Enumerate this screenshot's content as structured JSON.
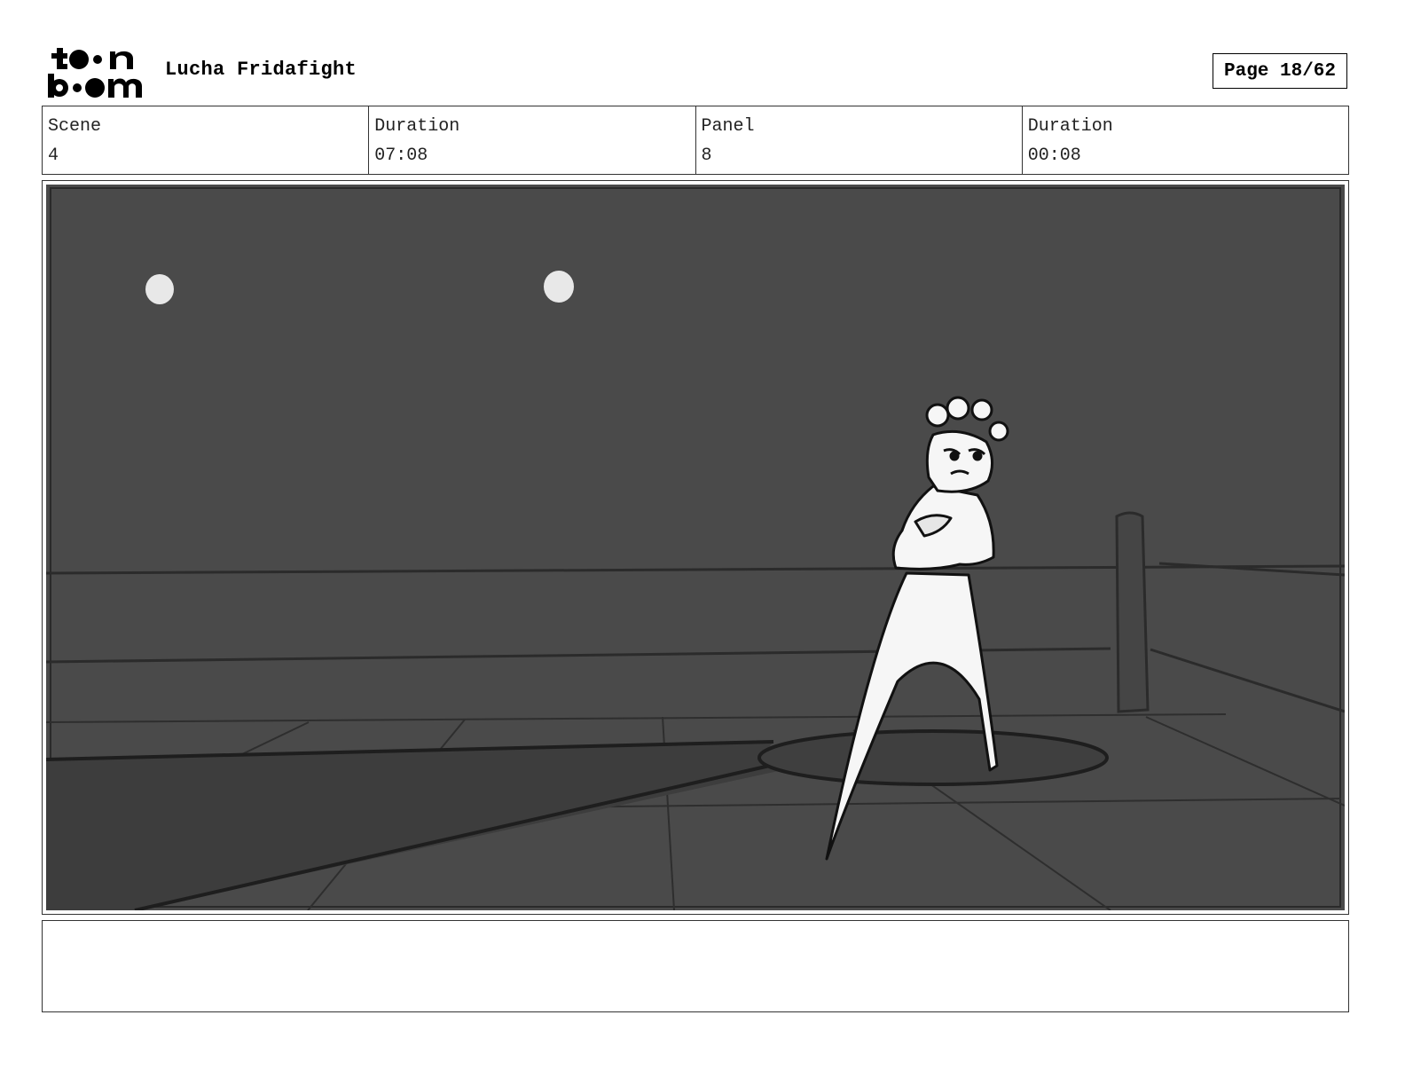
{
  "header": {
    "logo_text": "toonboom",
    "project_title": "Lucha Fridafight",
    "page_label": "Page 18/62"
  },
  "info": {
    "scene_label": "Scene",
    "scene_value": "4",
    "scene_duration_label": "Duration",
    "scene_duration_value": "07:08",
    "panel_label": "Panel",
    "panel_value": "8",
    "panel_duration_label": "Duration",
    "panel_duration_value": "00:08"
  },
  "notes": {
    "text": ""
  }
}
